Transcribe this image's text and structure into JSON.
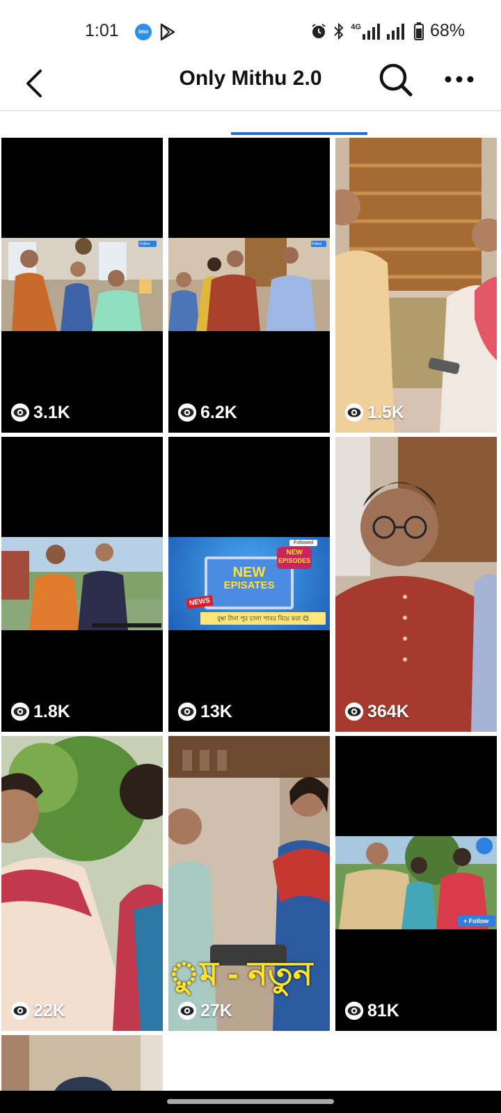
{
  "status_bar": {
    "time": "1:01",
    "notif_icons": [
      "imo-icon",
      "play-store-icon"
    ],
    "imo_label": "imo",
    "right_icons": [
      "alarm-icon",
      "bluetooth-icon",
      "4g-signal-icon",
      "signal-icon",
      "battery-icon"
    ],
    "network_label": "4G",
    "battery": "68%"
  },
  "header": {
    "title": "Only Mithu 2.0",
    "back_icon": "back-arrow-icon",
    "search_icon": "search-icon",
    "more_icon": "more-icon"
  },
  "colors": {
    "accent": "#1e6fd9",
    "tile_background": "#000000",
    "overlay_text": "#ffffff"
  },
  "videos": [
    {
      "views": "3.1K",
      "badge": "Follow"
    },
    {
      "views": "6.2K",
      "badge": "Follow"
    },
    {
      "views": "1.5K"
    },
    {
      "views": "1.8K"
    },
    {
      "views": "13K",
      "headline_1": "NEW",
      "headline_2": "EPISATES",
      "tag": "NEWS",
      "badge": "Followed",
      "sticker_1": "NEW",
      "sticker_2": "EPISODES",
      "caption": "বুম্বা টানা পুর চালা পাবর বিয়ে করা 😊"
    },
    {
      "views": "364K"
    },
    {
      "views": "22K"
    },
    {
      "views": "27K",
      "overlay_text": "ুম - নতুন"
    },
    {
      "views": "81K",
      "badge": "+ Follow"
    }
  ]
}
